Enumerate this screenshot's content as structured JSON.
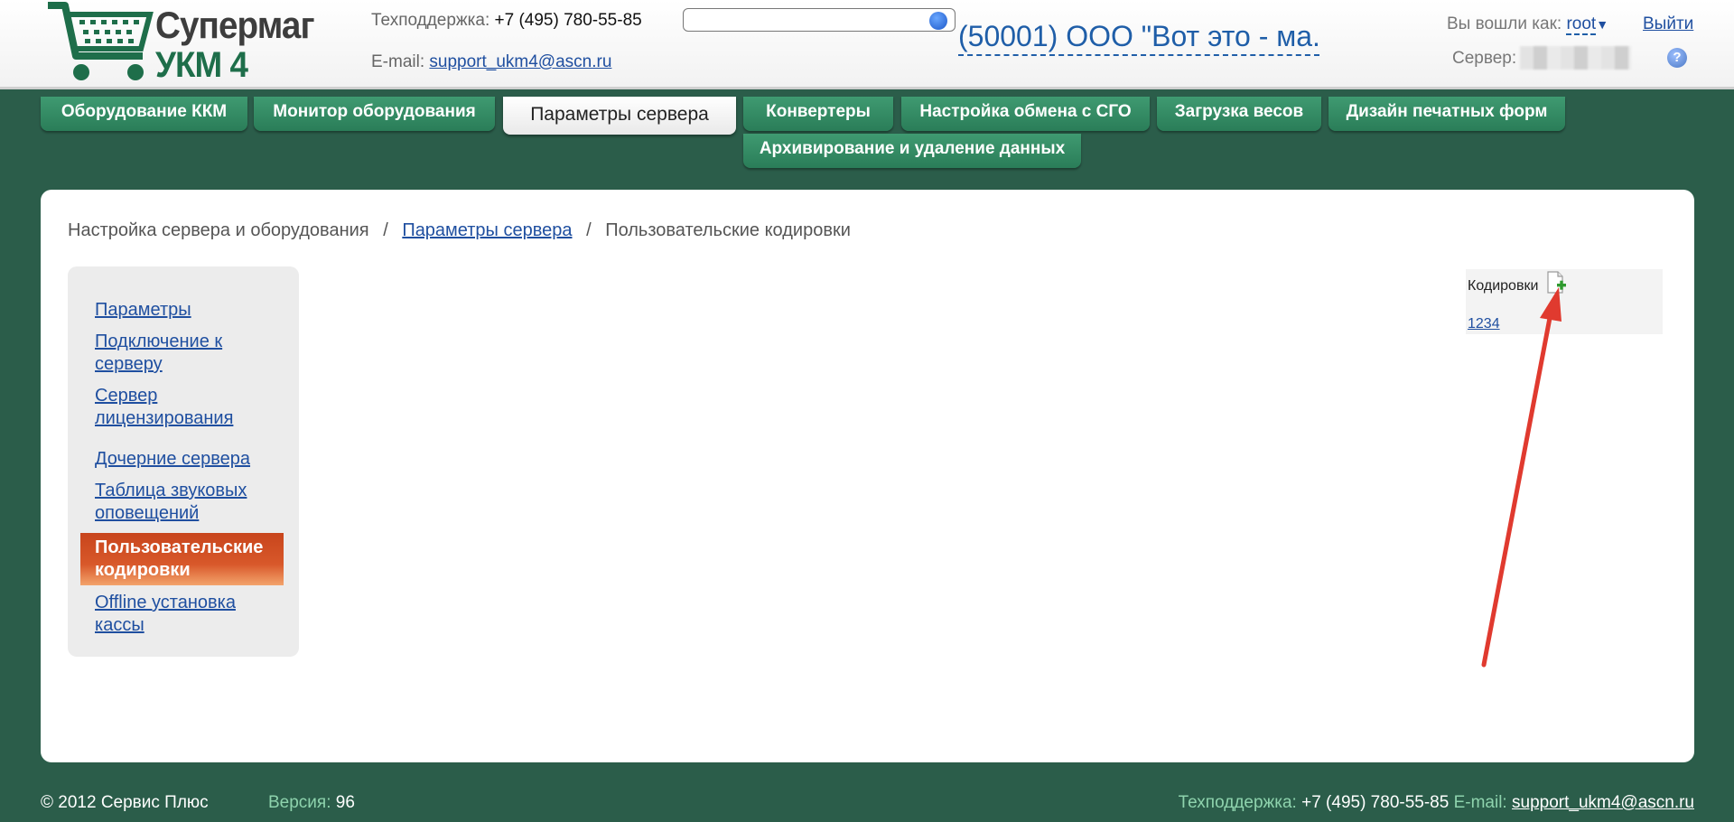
{
  "header": {
    "logo": {
      "line1": "Супермаг",
      "line2": "УКМ 4",
      "icon": "shopping-cart-icon"
    },
    "support_label": "Техподдержка:",
    "support_phone": "+7 (495) 780-55-85",
    "email_label": "E-mail:",
    "email": "support_ukm4@ascn.ru",
    "search": {
      "value": "",
      "placeholder": ""
    },
    "org_name": "(50001) ООО \"Вот это - ма...",
    "logged_in_label": "Вы вошли как:",
    "user": "root",
    "logout": "Выйти",
    "server_label": "Сервер:",
    "help": "?"
  },
  "tabs": [
    {
      "label": "Оборудование ККМ"
    },
    {
      "label": "Монитор оборудования"
    },
    {
      "label": "Параметры сервера",
      "active": true
    },
    {
      "label": "Конвертеры"
    },
    {
      "label": "Настройка обмена с СГО"
    },
    {
      "label": "Загрузка весов"
    },
    {
      "label": "Дизайн печатных форм"
    },
    {
      "label": "Архивирование и удаление данных"
    }
  ],
  "breadcrumb": {
    "root": "Настройка сервера и оборудования",
    "parent": "Параметры сервера",
    "current": "Пользовательские кодировки",
    "separator": "/"
  },
  "sidebar": {
    "items": [
      {
        "label": "Параметры"
      },
      {
        "label": "Подключение к серверу"
      },
      {
        "label": "Сервер лицензирования"
      },
      {
        "label": "Дочерние сервера"
      },
      {
        "label": "Таблица звуковых оповещений"
      },
      {
        "label": "Пользовательские кодировки",
        "active": true
      },
      {
        "label": "Offline установка кассы"
      }
    ]
  },
  "encodings": {
    "title": "Кодировки",
    "add_icon": "add-document-icon",
    "items": [
      "1234"
    ]
  },
  "footer": {
    "copyright": "© 2012 Сервис Плюс",
    "version_label": "Версия:",
    "version": "96",
    "support_label": "Техподдержка:",
    "support_phone": "+7 (495) 780-55-85",
    "email_label": "E-mail:",
    "email": "support_ukm4@ascn.ru"
  },
  "colors": {
    "background": "#2b5d4a",
    "tab": "#3f9a71",
    "active_sidebar": "#d8582a",
    "link": "#1f4fa0",
    "annotation_arrow": "#e03a2f"
  }
}
